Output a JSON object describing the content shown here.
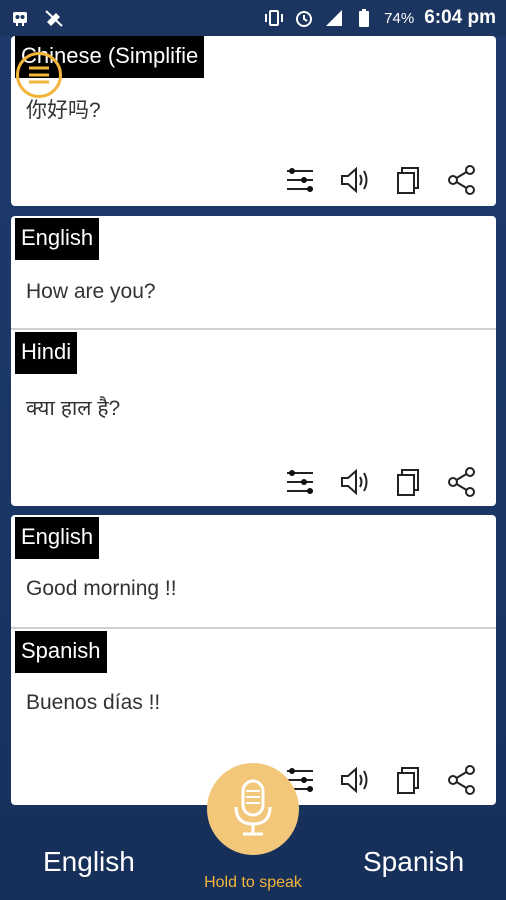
{
  "status_bar": {
    "battery_percent": "74%",
    "time": "6:04 pm"
  },
  "cards": [
    {
      "source": {
        "language": "Chinese (Simplifie",
        "text": "你好吗?"
      }
    },
    {
      "source": {
        "language": "English",
        "text": "How are you?"
      },
      "target": {
        "language": "Hindi",
        "text": "क्या हाल है?"
      }
    },
    {
      "source": {
        "language": "English",
        "text": "Good morning !!"
      },
      "target": {
        "language": "Spanish",
        "text": "Buenos días !!"
      }
    }
  ],
  "bottom_bar": {
    "left_language": "English",
    "right_language": "Spanish",
    "hold_label": "Hold to speak"
  },
  "colors": {
    "background": "#1e3a6b",
    "accent": "#f2b43a",
    "mic": "#f2c77a"
  }
}
